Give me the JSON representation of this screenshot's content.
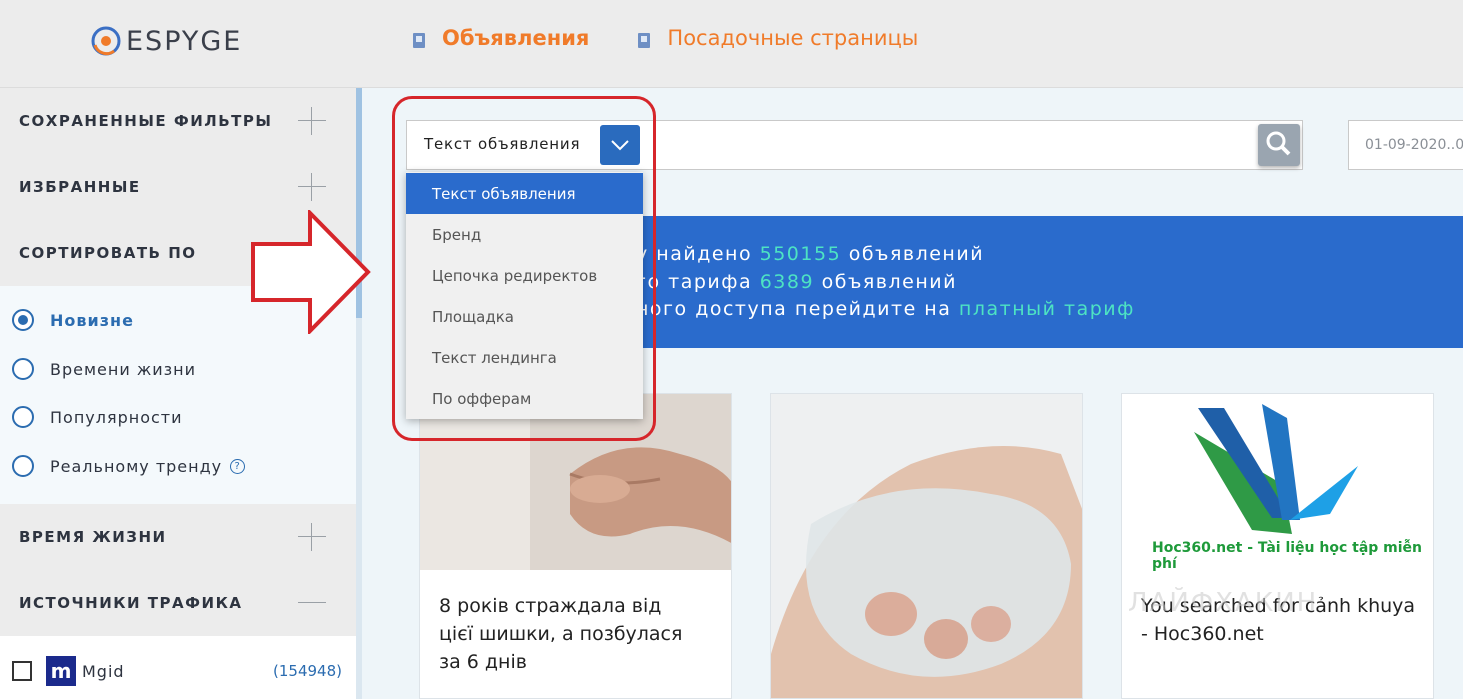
{
  "header": {
    "logo_text": "ESPYGE",
    "nav": [
      {
        "label": "Объявления",
        "active": true
      },
      {
        "label": "Посадочные страницы",
        "active": false
      }
    ]
  },
  "sidebar": {
    "saved_filters": "СОХРАНЕННЫЕ ФИЛЬТРЫ",
    "favorites": "ИЗБРАННЫЕ",
    "sort_by": "СОРТИРОВАТЬ ПО",
    "sort_options": [
      {
        "label": "Новизне",
        "selected": true
      },
      {
        "label": "Времени жизни",
        "selected": false
      },
      {
        "label": "Популярности",
        "selected": false
      },
      {
        "label": "Реальному тренду",
        "selected": false
      }
    ],
    "help_symbol": "?",
    "lifetime": "ВРЕМЯ ЖИЗНИ",
    "traffic_sources": "ИСТОЧНИКИ ТРАФИКА",
    "sources": [
      {
        "icon_letter": "m",
        "label": "Mgid",
        "count": "(154948)"
      }
    ]
  },
  "search": {
    "selected_mode": "Текст объявления",
    "date_value": "01-09-2020..0",
    "options": [
      "Текст объявления",
      "Бренд",
      "Цепочка редиректов",
      "Площадка",
      "Текст лендинга",
      "По офферам"
    ]
  },
  "banner": {
    "line1_prefix": "у найдено ",
    "line1_count": "550155",
    "line1_suffix": " объявлений",
    "line2_prefix": "го тарифа ",
    "line2_count": "6389",
    "line2_suffix": " объявлений",
    "line3_prefix": "ного доступа перейдите на ",
    "line3_link": "платный тариф"
  },
  "cards": [
    {
      "text": "8 років страждала від цієї шишки, а позбулася за 6 днів"
    },
    {
      "text": ""
    },
    {
      "text": "You searched for cảnh khuya - Hoc360.net",
      "image_caption": "Hoc360.net - Tài liệu học tập miễn phí"
    }
  ],
  "watermark": "ЛАЙФХАКИН",
  "colors": {
    "accent": "#2a6bcc",
    "brand_orange": "#f07b2a",
    "annotation_red": "#d6262b",
    "highlight": "#4de3c3"
  }
}
